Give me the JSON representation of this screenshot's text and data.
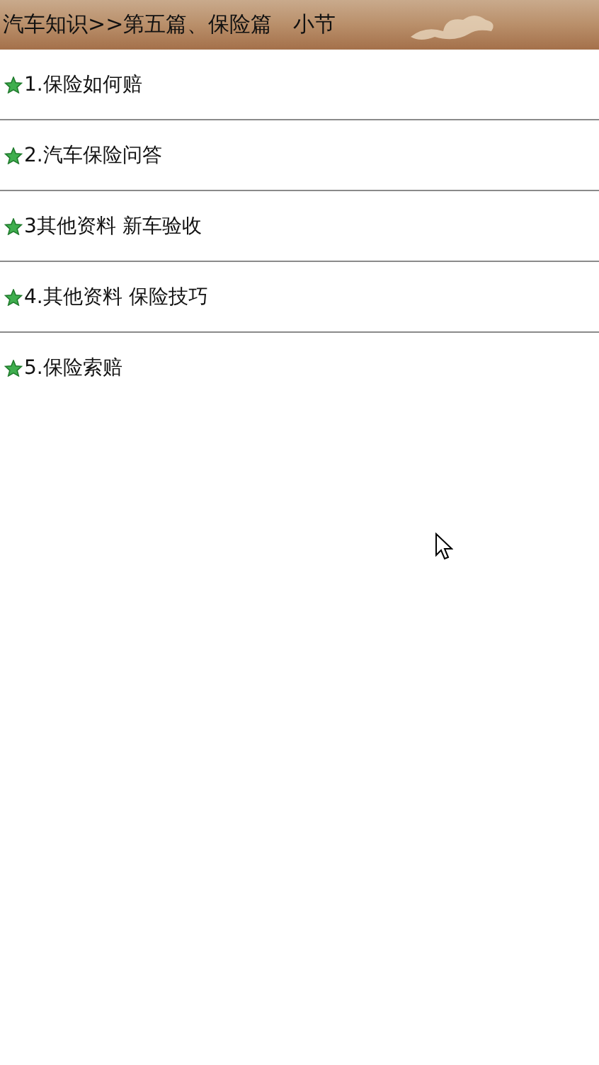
{
  "header": {
    "title": "汽车知识>>第五篇、保险篇　小节"
  },
  "items": [
    {
      "label": "1.保险如何赔"
    },
    {
      "label": "2.汽车保险问答"
    },
    {
      "label": "3其他资料  新车验收"
    },
    {
      "label": "4.其他资料  保险技巧"
    },
    {
      "label": "5.保险索赔"
    }
  ]
}
